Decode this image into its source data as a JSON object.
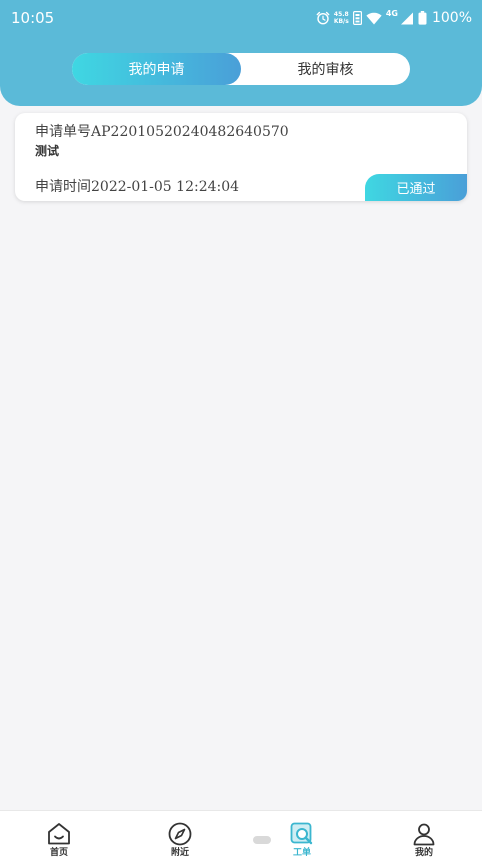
{
  "status_bar": {
    "time": "10:05",
    "net_speed_value": "45.8",
    "net_speed_unit": "KB/s",
    "network_type": "4G",
    "battery_percent": "100%",
    "icons": [
      "alarm-icon",
      "network-status-icon",
      "wifi-icon",
      "signal-icon",
      "battery-icon"
    ]
  },
  "tabs": [
    {
      "label": "我的申请",
      "active": true
    },
    {
      "label": "我的审核",
      "active": false
    }
  ],
  "applications": [
    {
      "number_label": "申请单号",
      "number": "AP22010520240482640570",
      "title": "测试",
      "time_label": "申请时间",
      "time": "2022-01-05 12:24:04",
      "status": "已通过"
    }
  ],
  "bottom_nav": [
    {
      "label": "首页",
      "icon": "home-icon",
      "active": false
    },
    {
      "label": "附近",
      "icon": "compass-icon",
      "active": false
    },
    {
      "label": "工单",
      "icon": "work-order-icon",
      "active": true
    },
    {
      "label": "我的",
      "icon": "user-icon",
      "active": false
    }
  ],
  "colors": {
    "header_bg": "#5bbad8",
    "accent_start": "#3fd7e2",
    "accent_end": "#4a9fd8",
    "nav_active": "#3bb6cf",
    "page_bg": "#f5f5f7"
  }
}
